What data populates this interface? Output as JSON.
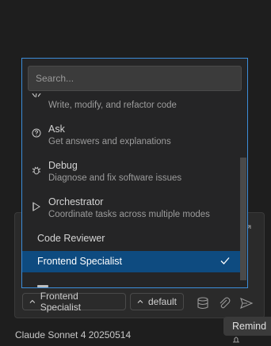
{
  "mode_picker": {
    "search_placeholder": "Search...",
    "items": [
      {
        "title": "",
        "description": "Write, modify, and refactor code",
        "icon": "code-icon"
      },
      {
        "title": "Ask",
        "description": "Get answers and explanations",
        "icon": "question-icon"
      },
      {
        "title": "Debug",
        "description": "Diagnose and fix software issues",
        "icon": "bug-icon"
      },
      {
        "title": "Orchestrator",
        "description": "Coordinate tasks across multiple modes",
        "icon": "run-icon"
      }
    ],
    "plain_items": [
      {
        "label": "Code Reviewer"
      },
      {
        "label": "Frontend Specialist",
        "selected": true
      }
    ],
    "accent_color": "#3c8dd9",
    "selected_color": "#0e4b80"
  },
  "toolbar": {
    "mode_button": "Frontend Specialist",
    "profile_button": "default"
  },
  "status": {
    "model": "Claude Sonnet 4 20250514",
    "tooltip": "Remind"
  }
}
